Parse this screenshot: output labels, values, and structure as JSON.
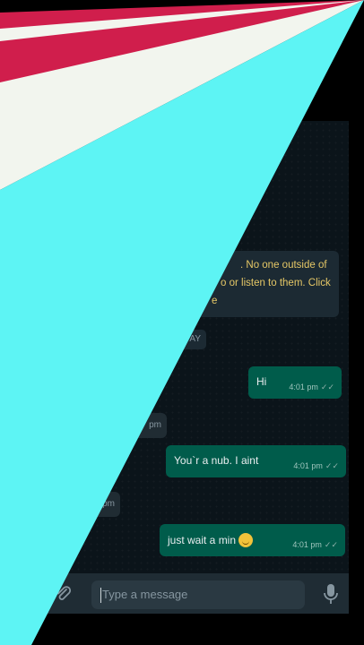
{
  "chat": {
    "encryption_notice": {
      "line1": ". No one outside of",
      "line2": "o or listen to them. Click",
      "line3": "e"
    },
    "date_chip": "AY",
    "messages": [
      {
        "text": "Hi",
        "time": "4:01 pm",
        "ticks": "✓✓",
        "direction": "outgoing"
      },
      {
        "text": "",
        "time": "pm",
        "direction": "incoming"
      },
      {
        "text": "You`r a nub. I aint",
        "time": "4:01 pm",
        "ticks": "✓✓",
        "direction": "outgoing"
      },
      {
        "text": "",
        "time": "pm",
        "direction": "incoming"
      },
      {
        "text": "just wait a min",
        "time": "4:01 pm",
        "ticks": "✓✓",
        "direction": "outgoing",
        "emoji": "smirk-emoji"
      }
    ]
  },
  "input_bar": {
    "placeholder": "Type a message"
  },
  "colors": {
    "chat_bg": "#0b141a",
    "outgoing_bubble": "#005c4b",
    "incoming_bubble": "#202c33",
    "notice_text": "#e5c766",
    "overlay_cyan": "#5df4f4",
    "overlay_red": "#d01e4c",
    "overlay_cream": "#f2f5ee"
  }
}
